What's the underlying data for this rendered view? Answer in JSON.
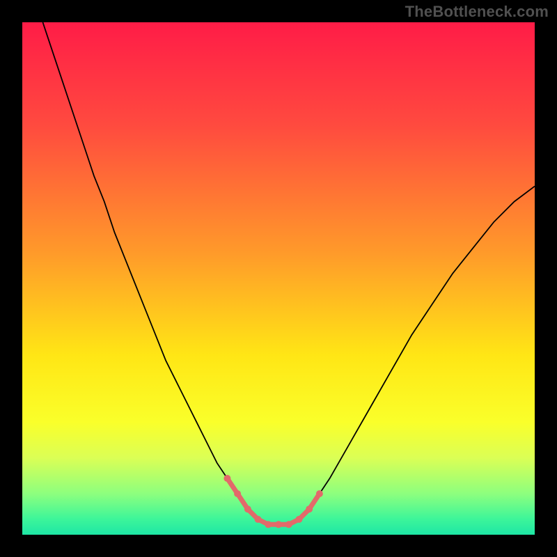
{
  "watermark": "TheBottleneck.com",
  "chart_data": {
    "type": "line",
    "title": "",
    "xlabel": "",
    "ylabel": "",
    "xlim": [
      0,
      100
    ],
    "ylim": [
      0,
      100
    ],
    "background_gradient_stops": [
      {
        "offset": 0,
        "color": "#ff1c47"
      },
      {
        "offset": 20,
        "color": "#ff4a3f"
      },
      {
        "offset": 45,
        "color": "#ff9a2a"
      },
      {
        "offset": 65,
        "color": "#ffe615"
      },
      {
        "offset": 78,
        "color": "#faff2a"
      },
      {
        "offset": 85,
        "color": "#dbff55"
      },
      {
        "offset": 92,
        "color": "#8dff7e"
      },
      {
        "offset": 97,
        "color": "#3cf59a"
      },
      {
        "offset": 100,
        "color": "#1ee6a5"
      }
    ],
    "series": [
      {
        "name": "curve",
        "stroke": "#000000",
        "stroke_width": 1.8,
        "x": [
          4,
          6,
          8,
          10,
          12,
          14,
          16,
          18,
          20,
          22,
          24,
          26,
          28,
          30,
          32,
          34,
          36,
          38,
          40,
          42,
          44,
          46,
          48,
          50,
          52,
          54,
          56,
          58,
          60,
          64,
          68,
          72,
          76,
          80,
          84,
          88,
          92,
          96,
          100
        ],
        "y": [
          100,
          94,
          88,
          82,
          76,
          70,
          65,
          59,
          54,
          49,
          44,
          39,
          34,
          30,
          26,
          22,
          18,
          14,
          11,
          8,
          5,
          3,
          2,
          2,
          2,
          3,
          5,
          8,
          11,
          18,
          25,
          32,
          39,
          45,
          51,
          56,
          61,
          65,
          68
        ]
      }
    ],
    "marker_segment": {
      "name": "floor-markers",
      "color": "#e26a6a",
      "stroke_width": 7,
      "marker_radius": 5,
      "x": [
        40,
        42,
        44,
        46,
        48,
        50,
        52,
        54,
        56,
        58
      ],
      "y": [
        11,
        8,
        5,
        3,
        2,
        2,
        2,
        3,
        5,
        8
      ]
    }
  }
}
